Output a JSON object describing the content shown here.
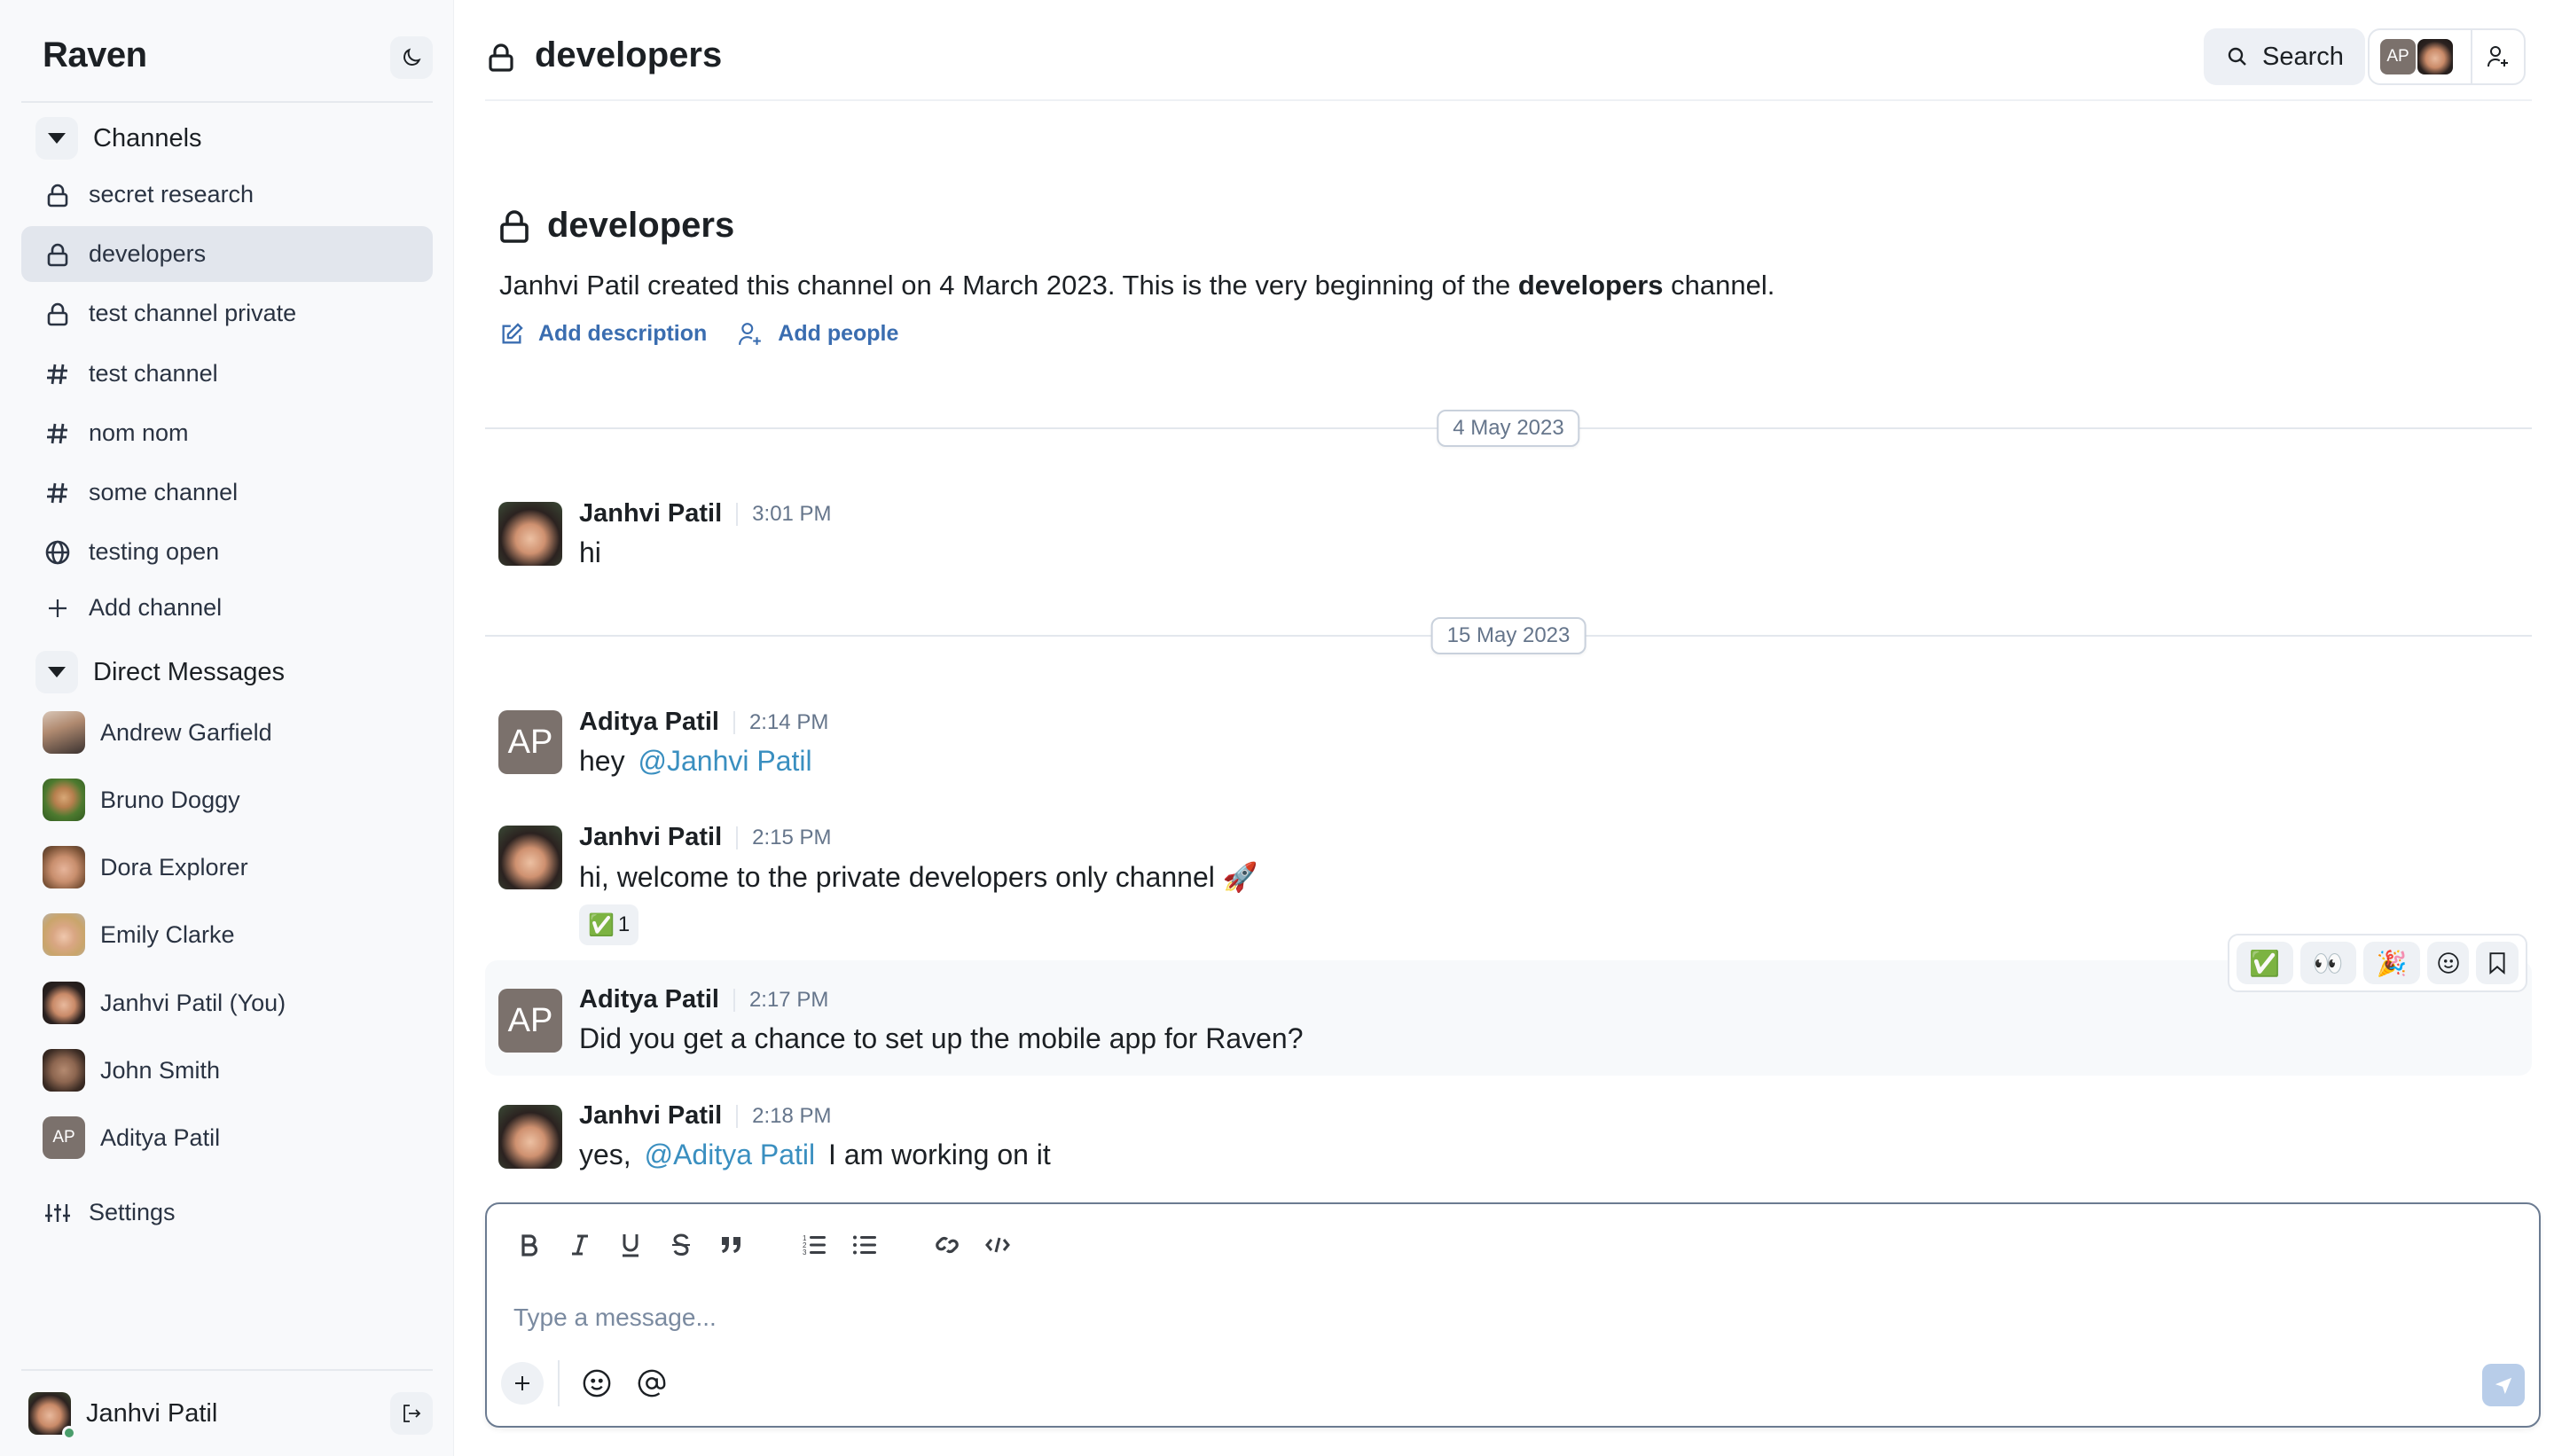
{
  "app": {
    "title": "Raven",
    "theme_toggle_icon": "moon-icon"
  },
  "sidebar": {
    "channels_header": "Channels",
    "channels": [
      {
        "label": "secret research",
        "icon": "lock-icon",
        "selected": false
      },
      {
        "label": "developers",
        "icon": "lock-icon",
        "selected": true
      },
      {
        "label": "test channel private",
        "icon": "lock-icon",
        "selected": false
      },
      {
        "label": "test channel",
        "icon": "hash-icon",
        "selected": false
      },
      {
        "label": "nom nom",
        "icon": "hash-icon",
        "selected": false
      },
      {
        "label": "some channel",
        "icon": "hash-icon",
        "selected": false
      },
      {
        "label": "testing open",
        "icon": "globe-icon",
        "selected": false
      }
    ],
    "add_channel_label": "Add channel",
    "dm_header": "Direct Messages",
    "direct_messages": [
      {
        "label": "Andrew Garfield",
        "avatar": "photo"
      },
      {
        "label": "Bruno Doggy",
        "avatar": "photo"
      },
      {
        "label": "Dora Explorer",
        "avatar": "photo"
      },
      {
        "label": "Emily Clarke",
        "avatar": "photo"
      },
      {
        "label": "Janhvi Patil (You)",
        "avatar": "photo"
      },
      {
        "label": "John Smith",
        "avatar": "photo"
      },
      {
        "label": "Aditya Patil",
        "avatar": "initials",
        "initials": "AP"
      }
    ],
    "settings_label": "Settings",
    "current_user": {
      "name": "Janhvi Patil",
      "status": "online"
    }
  },
  "header": {
    "channel_name": "developers",
    "search_label": "Search",
    "member_initials": "AP"
  },
  "intro": {
    "title": "developers",
    "text_prefix": "Janhvi Patil created this channel on 4 March 2023. This is the very beginning of the ",
    "text_bold": "developers",
    "text_suffix": " channel.",
    "add_description_label": "Add description",
    "add_people_label": "Add people"
  },
  "date_dividers": [
    "4 May 2023",
    "15 May 2023"
  ],
  "messages": [
    {
      "sender": "Janhvi Patil",
      "time": "3:01 PM",
      "avatar": "photo",
      "text": "hi"
    },
    {
      "sender": "Aditya Patil",
      "time": "2:14 PM",
      "avatar": "initials",
      "initials": "AP",
      "text_before": "hey",
      "mention": "@Janhvi Patil",
      "text_after": ""
    },
    {
      "sender": "Janhvi Patil",
      "time": "2:15 PM",
      "avatar": "photo",
      "text": "hi, welcome to the private developers only channel 🚀",
      "reaction": {
        "emoji": "✅",
        "count": "1"
      }
    },
    {
      "sender": "Aditya Patil",
      "time": "2:17 PM",
      "avatar": "initials",
      "initials": "AP",
      "text": "Did you get a chance to set up the mobile app for Raven?"
    },
    {
      "sender": "Janhvi Patil",
      "time": "2:18 PM",
      "avatar": "photo",
      "text_before": "yes,",
      "mention": "@Aditya Patil",
      "text_after": "I am working on it"
    }
  ],
  "message_actions": {
    "quick_reactions": [
      "✅",
      "👀",
      "🎉"
    ],
    "emoji_picker_icon": "smiley-icon",
    "bookmark_icon": "bookmark-icon"
  },
  "composer": {
    "placeholder": "Type a message...",
    "value": "",
    "toolbar": [
      "bold",
      "italic",
      "underline",
      "strikethrough",
      "quote",
      "ordered-list",
      "bullet-list",
      "link",
      "code"
    ]
  }
}
